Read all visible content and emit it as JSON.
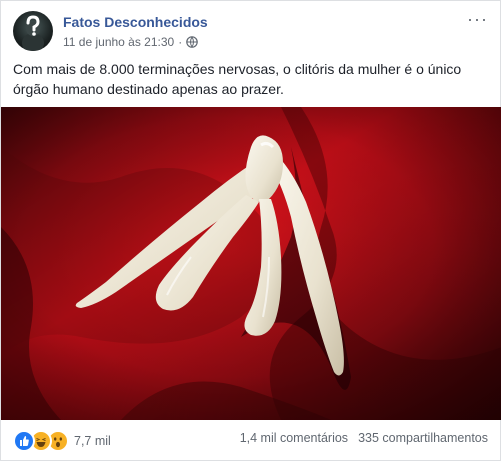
{
  "post": {
    "page_name": "Fatos Desconhecidos",
    "timestamp": "11 de junho às 21:30",
    "separator": "·",
    "more_label": "···",
    "body_text": "Com mais de 8.000 terminações nervosas, o clitóris da mulher é o único órgão humano destinado apenas ao prazer."
  },
  "footer": {
    "reactions": [
      "like-icon",
      "haha-icon",
      "wow-icon"
    ],
    "reaction_count": "7,7 mil",
    "comments": "1,4 mil comentários",
    "shares": "335 compartilhamentos"
  },
  "colors": {
    "link_blue": "#385898",
    "like_blue": "#2078f4",
    "reaction_yellow": "#f7b125",
    "photo_red": "#c8141c"
  }
}
